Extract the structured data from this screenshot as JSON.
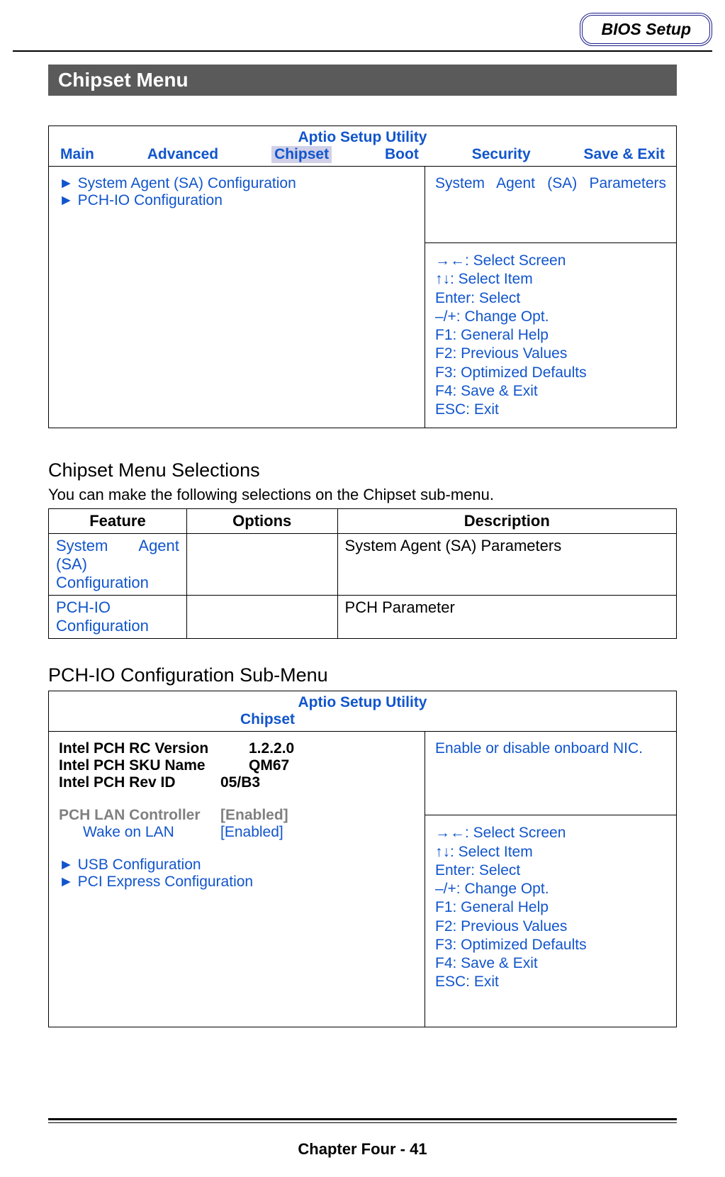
{
  "header": {
    "tag": "BIOS Setup"
  },
  "title_bar": "Chipset Menu",
  "bios1": {
    "utility_title": "Aptio Setup Utility",
    "tabs": [
      "Main",
      "Advanced",
      "Chipset",
      "Boot",
      "Security",
      "Save & Exit"
    ],
    "menu_items": [
      "System Agent (SA) Configuration",
      "PCH-IO Configuration"
    ],
    "info": "System Agent (SA) Parameters",
    "help": [
      "→←: Select Screen",
      "↑↓: Select Item",
      "Enter: Select",
      "–/+: Change Opt.",
      "F1: General Help",
      "F2: Previous Values",
      "F3: Optimized Defaults",
      "F4: Save & Exit",
      "ESC: Exit"
    ]
  },
  "selections": {
    "heading": "Chipset Menu Selections",
    "intro": "You can make the following selections on the Chipset sub-menu.",
    "headers": {
      "c1": "Feature",
      "c2": "Options",
      "c3": "Description"
    },
    "rows": [
      {
        "feature_line1": "System Agent",
        "feature_line2": "(SA)",
        "feature_line3": "Configuration",
        "options": "",
        "description": "System Agent (SA) Parameters"
      },
      {
        "feature_line1": "PCH-IO",
        "feature_line3": "Configuration",
        "options": "",
        "description": "PCH Parameter"
      }
    ]
  },
  "pchio": {
    "heading": "PCH-IO Configuration Sub-Menu",
    "utility_title": "Aptio Setup Utility",
    "tab": "Chipset",
    "info_rows": [
      {
        "label": "Intel PCH RC Version",
        "value": "1.2.2.0"
      },
      {
        "label": "Intel PCH SKU Name",
        "value": "QM67"
      },
      {
        "label": "Intel PCH Rev ID",
        "value": "05/B3"
      }
    ],
    "gray_row": {
      "label": "PCH LAN Controller",
      "value": "[Enabled]"
    },
    "wol": {
      "label": "Wake on LAN",
      "value": "[Enabled]"
    },
    "submenus": [
      "USB Configuration",
      "PCI Express Configuration"
    ],
    "right_info": "Enable or disable onboard NIC.",
    "help": [
      "→←: Select Screen",
      "↑↓: Select Item",
      "Enter: Select",
      "–/+: Change Opt.",
      "F1: General Help",
      "F2: Previous Values",
      "F3: Optimized Defaults",
      "F4: Save & Exit",
      "ESC: Exit"
    ]
  },
  "footer": "Chapter Four - 41"
}
